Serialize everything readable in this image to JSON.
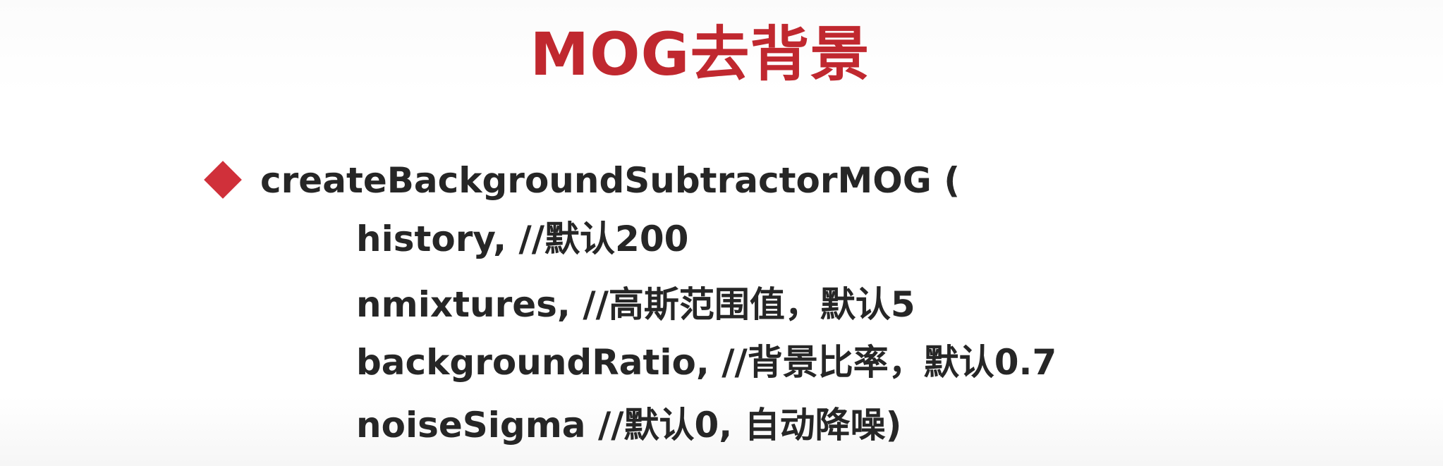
{
  "slide": {
    "title": "MOG去背景",
    "function_call": "createBackgroundSubtractorMOG (",
    "params": [
      "history, //默认200",
      "nmixtures,  //高斯范围值，默认5",
      "backgroundRatio, //背景比率，默认0.7",
      "noiseSigma //默认0, 自动降噪)"
    ],
    "colors": {
      "title": "#c0282f",
      "bullet": "#d0303a",
      "text": "#262626"
    },
    "icons": {
      "bullet": "diamond-bullet-icon"
    }
  }
}
